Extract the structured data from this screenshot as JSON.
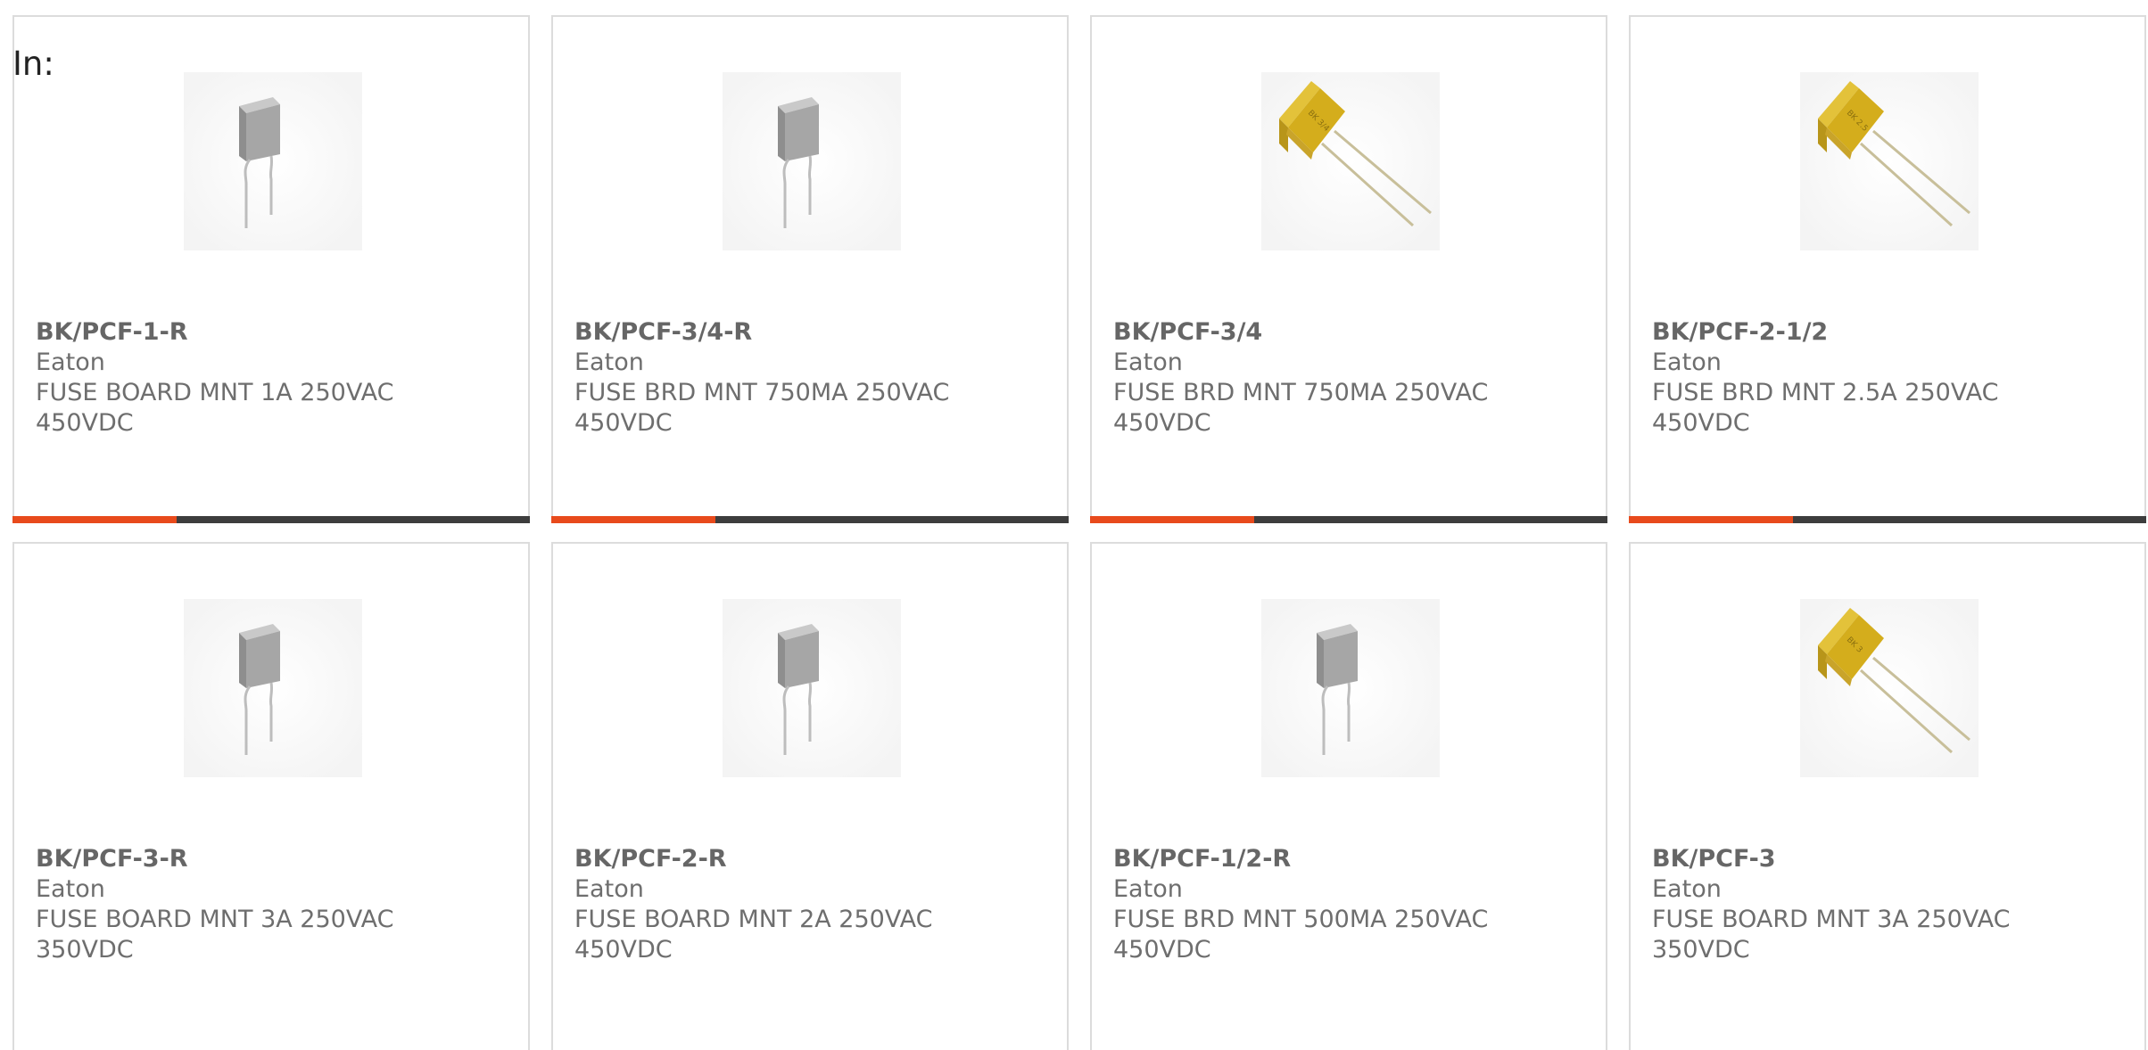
{
  "header": {
    "label": "In:"
  },
  "colors": {
    "accent": "#e84a1c",
    "bar": "#3d3d3d",
    "border": "#dcdcdc",
    "text": "#6e6e6e"
  },
  "products": [
    {
      "part": "BK/PCF-1-R",
      "brand": "Eaton",
      "desc1": "FUSE BOARD MNT 1A 250VAC",
      "desc2": "450VDC",
      "image": "gray-radial-fuse-icon"
    },
    {
      "part": "BK/PCF-3/4-R",
      "brand": "Eaton",
      "desc1": "FUSE BRD MNT 750MA 250VAC",
      "desc2": "450VDC",
      "image": "gray-radial-fuse-icon"
    },
    {
      "part": "BK/PCF-3/4",
      "brand": "Eaton",
      "desc1": "FUSE BRD MNT 750MA 250VAC",
      "desc2": "450VDC",
      "image": "yellow-radial-fuse-icon"
    },
    {
      "part": "BK/PCF-2-1/2",
      "brand": "Eaton",
      "desc1": "FUSE BRD MNT 2.5A 250VAC",
      "desc2": "450VDC",
      "image": "yellow-radial-fuse-icon"
    },
    {
      "part": "BK/PCF-3-R",
      "brand": "Eaton",
      "desc1": "FUSE BOARD MNT 3A 250VAC",
      "desc2": "350VDC",
      "image": "gray-radial-fuse-icon"
    },
    {
      "part": "BK/PCF-2-R",
      "brand": "Eaton",
      "desc1": "FUSE BOARD MNT 2A 250VAC",
      "desc2": "450VDC",
      "image": "gray-radial-fuse-icon"
    },
    {
      "part": "BK/PCF-1/2-R",
      "brand": "Eaton",
      "desc1": "FUSE BRD MNT 500MA 250VAC",
      "desc2": "450VDC",
      "image": "gray-radial-fuse-icon"
    },
    {
      "part": "BK/PCF-3",
      "brand": "Eaton",
      "desc1": "FUSE BOARD MNT 3A 250VAC",
      "desc2": "350VDC",
      "image": "yellow-radial-fuse-icon"
    }
  ]
}
